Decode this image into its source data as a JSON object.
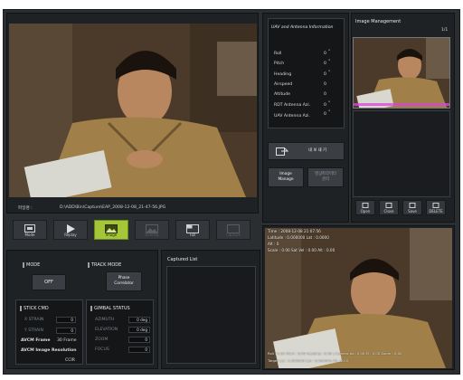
{
  "main_video": {
    "filename_label": "파일명 :",
    "filepath": "D:\\ADD\\Bin\\Capture\\EAP_2008-12-08_21-47-56.JPG"
  },
  "toolbar": [
    {
      "label": "Mode",
      "icon": "mode-icon",
      "state": "normal"
    },
    {
      "label": "Replay",
      "icon": "play-icon",
      "state": "normal"
    },
    {
      "label": "Image",
      "icon": "image-icon",
      "state": "active"
    },
    {
      "label": "Overlay",
      "icon": "overlay-icon",
      "state": "disabled"
    },
    {
      "label": "Full",
      "icon": "fullscreen-icon",
      "state": "normal"
    },
    {
      "label": "Capture",
      "icon": "capture-icon",
      "state": "disabled"
    }
  ],
  "uav_info": {
    "title": "UAV and Antenna Information",
    "rows": [
      {
        "label": "Roll",
        "value": "0",
        "unit": "°"
      },
      {
        "label": "Pitch",
        "value": "0",
        "unit": "°"
      },
      {
        "label": "Heading",
        "value": "0",
        "unit": "°"
      },
      {
        "label": "Airspeed",
        "value": "0",
        "unit": ""
      },
      {
        "label": "Altitude",
        "value": "0",
        "unit": ""
      },
      {
        "label": "RDT Antenna Azi.",
        "value": "0",
        "unit": "°"
      },
      {
        "label": "UAV Antenna Azi.",
        "value": "0",
        "unit": "°"
      }
    ]
  },
  "actions": {
    "export_label": "내 보 내 기",
    "image_manage_label": "Image Manage",
    "imaging_params_label": "영상파라미터 관리"
  },
  "image_management": {
    "title": "Image Management",
    "page": "1/1",
    "buttons": [
      "Open",
      "Close",
      "Save",
      "DELETE"
    ]
  },
  "mode": {
    "title": "MODE",
    "off_label": "OFF"
  },
  "track_mode": {
    "title": "TRACK MODE",
    "button_label": "Phase Correlator"
  },
  "stick_cmd": {
    "title": "STICK CMD",
    "rows": [
      {
        "label": "X STRAIN",
        "value": "0"
      },
      {
        "label": "Y STRAIN",
        "value": "0"
      }
    ],
    "avcm_frame_label": "AVCM Frame",
    "avcm_frame_value": "30 Frame",
    "avcm_res_label": "AVCM Image Resolution",
    "avcm_res_value": "CCIR"
  },
  "gimbal": {
    "title": "GIMBAL STATUS",
    "rows": [
      {
        "label": "AZIMUTH",
        "value": "0 deg"
      },
      {
        "label": "ELEVATION",
        "value": "0 deg"
      },
      {
        "label": "ZOOM",
        "value": "0"
      },
      {
        "label": "FOCUS",
        "value": "0"
      }
    ]
  },
  "captured_list": {
    "title": "Captured List"
  },
  "live_overlay": {
    "time": "Time : 2008-12-08 21:07:56",
    "line2": "Latitude : 0.000000 Lat : 0.0000",
    "line3": "Alt : 0",
    "line4": "Scale : 0.00 Sat Vel : 0.00 Alt : 0.00",
    "bottom1": "Roll : 0.00  Pitch : 0.00  Heading : 0.00  |  Camera Az : 0.00  El : 0.00  Zoom : 0.00",
    "bottom2": "Target Lat : 0.000000  Lon : 0.000000  Alt : 0.00"
  },
  "colors": {
    "background": "#2b2e31",
    "panel": "#1f2225",
    "active_green": "#a6c63a",
    "thumb_overlay": "#e040e0"
  }
}
